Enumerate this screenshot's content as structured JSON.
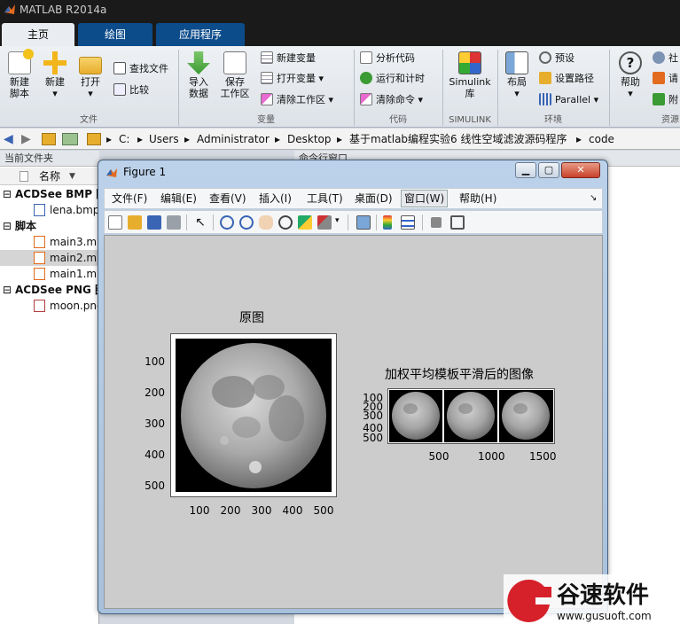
{
  "app": {
    "title": "MATLAB R2014a"
  },
  "tabs": [
    {
      "label": "主页"
    },
    {
      "label": "绘图"
    },
    {
      "label": "应用程序"
    }
  ],
  "ribbon": {
    "new_script": "新建\n脚本",
    "new": "新建",
    "open": "打开",
    "find_files": "查找文件",
    "compare": "比较",
    "import_data": "导入\n数据",
    "save_ws": "保存\n工作区",
    "new_var": "新建变量",
    "open_var": "打开变量",
    "clear_ws": "清除工作区",
    "analyze": "分析代码",
    "run_time": "运行和计时",
    "clear_cmd": "清除命令",
    "simulink": "Simulink\n库",
    "layout": "布局",
    "prefs": "预设",
    "set_path": "设置路径",
    "parallel": "Parallel",
    "help": "帮助",
    "community": "社",
    "request": "请",
    "addons": "附",
    "groups": {
      "file": "文件",
      "variable": "变量",
      "code": "代码",
      "simulink": "SIMULINK",
      "env": "环境",
      "resources": "资源"
    }
  },
  "address": {
    "parts": [
      "C:",
      "Users",
      "Administrator",
      "Desktop",
      "基于matlab编程实验6 线性空域滤波源码程序",
      "code"
    ]
  },
  "file_panel": {
    "header": "当前文件夹",
    "col_name": "名称",
    "items": [
      {
        "type": "cat",
        "label": "ACDSee BMP 图"
      },
      {
        "type": "file",
        "label": "lena.bmp",
        "icon": "bmp-icon"
      },
      {
        "type": "cat",
        "label": "脚本"
      },
      {
        "type": "file",
        "label": "main3.m",
        "icon": "m-file-icon"
      },
      {
        "type": "file",
        "label": "main2.m",
        "icon": "m-file-icon",
        "selected": true
      },
      {
        "type": "file",
        "label": "main1.m",
        "icon": "m-file-icon"
      },
      {
        "type": "cat",
        "label": "ACDSee PNG 图"
      },
      {
        "type": "file",
        "label": "moon.png",
        "icon": "png-icon"
      }
    ]
  },
  "cmd_panel": {
    "header": "命令行窗口"
  },
  "figure": {
    "title": "Figure 1",
    "menus": [
      "文件(F)",
      "编辑(E)",
      "查看(V)",
      "插入(I)",
      "工具(T)",
      "桌面(D)",
      "窗口(W)",
      "帮助(H)"
    ],
    "ax1": {
      "title": "原图",
      "yticks": [
        "100",
        "200",
        "300",
        "400",
        "500"
      ],
      "xticks": [
        "100",
        "200",
        "300",
        "400",
        "500"
      ]
    },
    "ax2": {
      "title": "加权平均模板平滑后的图像",
      "yticks": [
        "100",
        "200",
        "300",
        "400",
        "500"
      ],
      "xticks": [
        "500",
        "1000",
        "1500"
      ]
    }
  },
  "watermark": {
    "brand": "谷速软件",
    "url": "www.gusuoft.com"
  },
  "colors": {
    "accent": "#0d4c8b",
    "figure_bg": "#cccccc"
  }
}
